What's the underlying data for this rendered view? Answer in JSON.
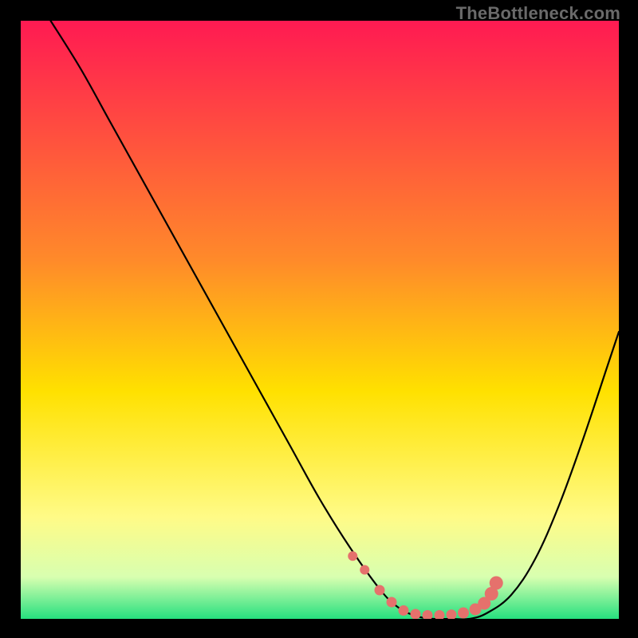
{
  "watermark": "TheBottleneck.com",
  "colors": {
    "frame": "#000000",
    "curve": "#000000",
    "marker": "#e5716c",
    "gradient_top": "#ff1a52",
    "gradient_mid1": "#ff8a2a",
    "gradient_mid2": "#ffe100",
    "gradient_low1": "#fffb87",
    "gradient_low2": "#d8ffb0",
    "gradient_bottom": "#26e07f"
  },
  "chart_data": {
    "type": "line",
    "title": "",
    "xlabel": "",
    "ylabel": "",
    "xlim": [
      0,
      100
    ],
    "ylim": [
      0,
      100
    ],
    "series": [
      {
        "name": "bottleneck-curve",
        "x": [
          5,
          10,
          15,
          20,
          25,
          30,
          35,
          40,
          45,
          50,
          55,
          60,
          63,
          66,
          69,
          72,
          75,
          78,
          82,
          86,
          90,
          94,
          98,
          100
        ],
        "y": [
          100,
          92,
          83,
          74,
          65,
          56,
          47,
          38,
          29,
          20,
          12,
          5,
          2,
          0.5,
          0,
          0,
          0,
          1,
          4,
          10,
          19,
          30,
          42,
          48
        ]
      }
    ],
    "markers": {
      "name": "highlight-dots",
      "x": [
        55.5,
        57.5,
        60,
        62,
        64,
        66,
        68,
        70,
        72,
        74,
        76,
        77.5,
        78.7,
        79.5
      ],
      "y": [
        10.5,
        8.2,
        4.8,
        2.8,
        1.4,
        0.8,
        0.6,
        0.6,
        0.7,
        1.0,
        1.6,
        2.6,
        4.2,
        6.0
      ],
      "r": [
        6,
        6,
        6.5,
        6.5,
        6.5,
        6.5,
        6.5,
        6.5,
        6.5,
        7,
        7.5,
        8,
        8.5,
        8.5
      ]
    }
  }
}
